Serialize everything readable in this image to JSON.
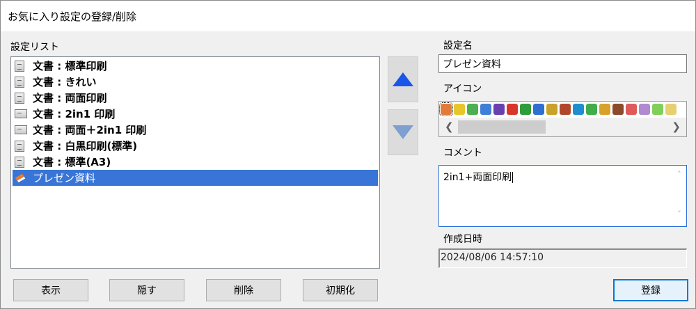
{
  "window": {
    "title": "お気に入り設定の登録/削除"
  },
  "settings_list": {
    "label": "設定リスト",
    "items": [
      {
        "text": "文書 : 標準印刷",
        "icon": "document-icon"
      },
      {
        "text": "文書 : きれい",
        "icon": "document-icon"
      },
      {
        "text": "文書 : 両面印刷",
        "icon": "duplex-document-icon"
      },
      {
        "text": "文書 : 2in1 印刷",
        "icon": "two-in-one-icon"
      },
      {
        "text": "文書 : 両面＋2in1 印刷",
        "icon": "duplex-two-in-one-icon"
      },
      {
        "text": "文書 : 白黒印刷(標準)",
        "icon": "document-icon"
      },
      {
        "text": "文書 : 標準(A3)",
        "icon": "document-icon"
      },
      {
        "text": "プレゼン資料",
        "icon": "book-icon",
        "selected": true
      }
    ]
  },
  "move_up": {
    "icon": "arrow-up-icon",
    "color": "#1a56e8"
  },
  "move_down": {
    "icon": "arrow-down-icon",
    "color": "#7e9fd0"
  },
  "setting_name": {
    "label": "設定名",
    "value": "プレゼン資料"
  },
  "icon_picker": {
    "label": "アイコン",
    "colors": [
      "#e07b39",
      "#e6c62b",
      "#4caf50",
      "#3f7fd9",
      "#6a3fb0",
      "#d9362b",
      "#2e9c3a",
      "#2f6fd0",
      "#c9a12b",
      "#b0472b",
      "#1d8fcf",
      "#3fae4a",
      "#d8a12b",
      "#8b4a2b",
      "#e05a5a",
      "#b08ad0",
      "#7fcf5a",
      "#e6d070"
    ]
  },
  "comment": {
    "label": "コメント",
    "value": "2in1+両面印刷"
  },
  "created": {
    "label": "作成日時",
    "value": "2024/08/06 14:57:10"
  },
  "buttons": {
    "show": "表示",
    "hide": "隠す",
    "delete": "削除",
    "reset": "初期化",
    "register": "登録"
  }
}
